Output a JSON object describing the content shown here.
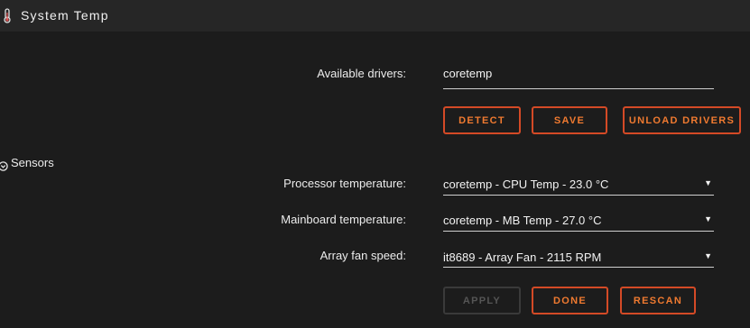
{
  "header": {
    "title": "System Temp",
    "icon": "thermometer-icon"
  },
  "drivers": {
    "label": "Available drivers:",
    "value": "coretemp",
    "buttons": {
      "detect": "DETECT",
      "save": "SAVE",
      "unload": "UNLOAD DRIVERS"
    }
  },
  "sensors": {
    "section_title": "Sensors",
    "section_icon": "collapse-circle-icon",
    "processor": {
      "label": "Processor temperature:",
      "value": "coretemp - CPU Temp - 23.0 °C"
    },
    "mainboard": {
      "label": "Mainboard temperature:",
      "value": "coretemp - MB Temp - 27.0 °C"
    },
    "fan": {
      "label": "Array fan speed:",
      "value": "it8689 - Array Fan - 2115 RPM"
    },
    "dropdown_arrow": "▼",
    "buttons": {
      "apply": "APPLY",
      "done": "DONE",
      "rescan": "RESCAN"
    }
  },
  "colors": {
    "accent": "#f07a30",
    "border": "#d44a26",
    "background": "#1c1c1c",
    "header": "#262626"
  }
}
